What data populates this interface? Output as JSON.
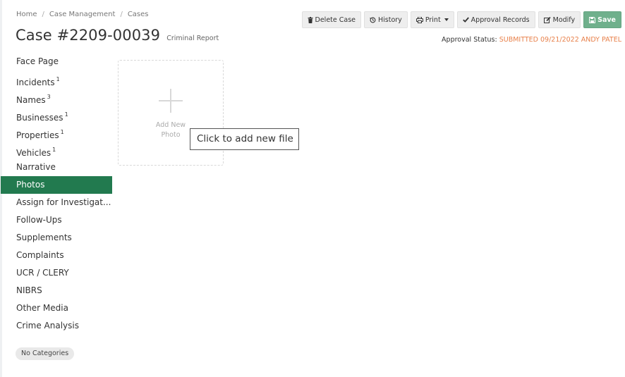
{
  "breadcrumb": {
    "items": [
      "Home",
      "Case Management",
      "Cases"
    ],
    "separator": "/"
  },
  "case": {
    "title": "Case #2209-00039",
    "type": "Criminal Report"
  },
  "toolbar": {
    "delete_label": "Delete Case",
    "history_label": "History",
    "print_label": "Print",
    "approval_label": "Approval Records",
    "modify_label": "Modify",
    "save_label": "Save"
  },
  "approval": {
    "label": "Approval Status:",
    "value": "SUBMITTED 09/21/2022 ANDY PATEL"
  },
  "sidebar": {
    "items": [
      {
        "label": "Face Page",
        "count": ""
      },
      {
        "label": "Incidents",
        "count": "1"
      },
      {
        "label": "Names",
        "count": "3"
      },
      {
        "label": "Businesses",
        "count": "1"
      },
      {
        "label": "Properties",
        "count": "1"
      },
      {
        "label": "Vehicles",
        "count": "1"
      },
      {
        "label": "Narrative",
        "count": ""
      },
      {
        "label": "Photos",
        "count": ""
      },
      {
        "label": "Assign for Investigat...",
        "count": ""
      },
      {
        "label": "Follow-Ups",
        "count": ""
      },
      {
        "label": "Supplements",
        "count": ""
      },
      {
        "label": "Complaints",
        "count": ""
      },
      {
        "label": "UCR / CLERY",
        "count": ""
      },
      {
        "label": "NIBRS",
        "count": ""
      },
      {
        "label": "Other Media",
        "count": ""
      },
      {
        "label": "Crime Analysis",
        "count": ""
      }
    ],
    "active_index": 7
  },
  "categories": {
    "label": "No Categories"
  },
  "upload": {
    "label_line1": "Add New",
    "label_line2": "Photo",
    "tooltip": "Click to add new file"
  },
  "icons": {
    "delete": "trash-icon",
    "history": "history-icon",
    "print": "print-icon",
    "approval": "check-icon",
    "modify": "edit-icon",
    "save": "save-icon",
    "add": "plus-icon"
  },
  "colors": {
    "active_nav": "#227a4f",
    "save_button": "#6fb08c",
    "approval_value": "#e8804a"
  }
}
